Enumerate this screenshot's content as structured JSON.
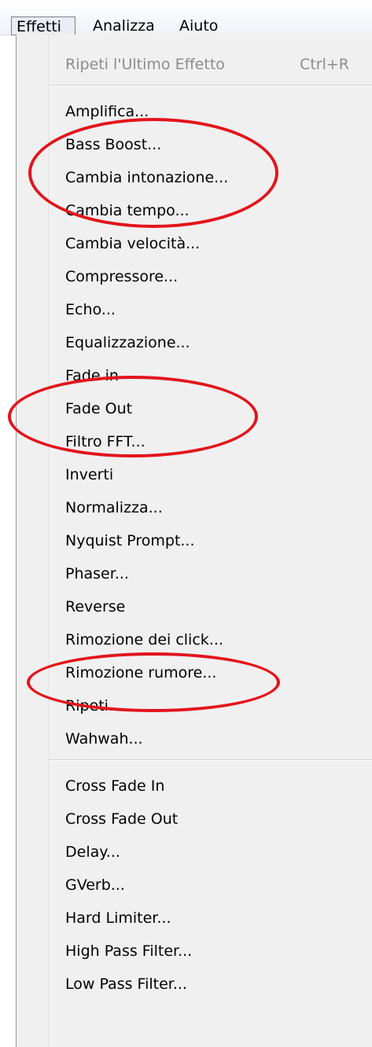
{
  "menubar": {
    "items": [
      "Effetti",
      "Analizza",
      "Aiuto"
    ]
  },
  "menu": {
    "repeat_last": {
      "label": "Ripeti l'Ultimo Effetto",
      "shortcut": "Ctrl+R"
    },
    "group1": [
      "Amplifica...",
      "Bass Boost...",
      "Cambia intonazione...",
      "Cambia tempo...",
      "Cambia velocità...",
      "Compressore...",
      "Echo...",
      "Equalizzazione...",
      "Fade in",
      "Fade Out",
      "Filtro FFT...",
      "Inverti",
      "Normalizza...",
      "Nyquist Prompt...",
      "Phaser...",
      "Reverse",
      "Rimozione dei click...",
      "Rimozione rumore...",
      "Ripeti...",
      "Wahwah..."
    ],
    "group2": [
      "Cross Fade In",
      "Cross Fade Out",
      "Delay...",
      "GVerb...",
      "Hard Limiter...",
      "High Pass Filter...",
      "Low Pass Filter..."
    ]
  },
  "annotation_color": "#e3141c"
}
